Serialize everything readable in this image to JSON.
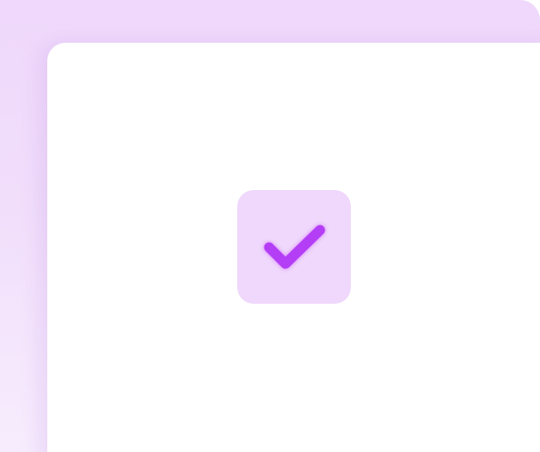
{
  "colors": {
    "frame_background": "#efd8fb",
    "panel_background": "#ffffff",
    "tile_background": "#efd8fb",
    "check_color": "#b43cf6"
  },
  "checkbox": {
    "icon": "checkmark-icon",
    "checked": true
  }
}
